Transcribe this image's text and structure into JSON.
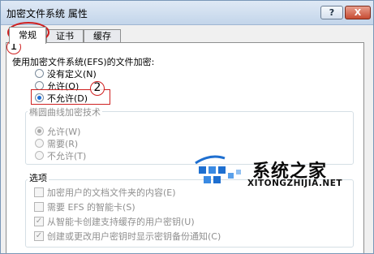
{
  "window": {
    "title": "加密文件系统 属性",
    "help_label": "?",
    "close_label": "X"
  },
  "tabs": [
    {
      "label": "常规",
      "active": true
    },
    {
      "label": "证书",
      "active": false
    },
    {
      "label": "缓存",
      "active": false
    }
  ],
  "efs": {
    "heading": "使用加密文件系统(EFS)的文件加密:",
    "options": [
      {
        "label": "没有定义(N)",
        "selected": false
      },
      {
        "label": "允许(O)",
        "selected": false
      },
      {
        "label": "不允许(D)",
        "selected": true
      }
    ]
  },
  "ecc": {
    "legend": "椭圆曲线加密技术",
    "options": [
      {
        "label": "允许(W)",
        "selected": true
      },
      {
        "label": "需要(R)",
        "selected": false
      },
      {
        "label": "不允许(T)",
        "selected": false
      }
    ]
  },
  "opts": {
    "legend": "选项",
    "checks": [
      {
        "label": "加密用户的文档文件夹的内容(E)",
        "checked": false
      },
      {
        "label": "需要 EFS 的智能卡(S)",
        "checked": false
      },
      {
        "label": "从智能卡创建支持缓存的用户密钥(U)",
        "checked": true
      },
      {
        "label": "创建或更改用户密钥时显示密钥备份通知(C)",
        "checked": true
      }
    ]
  },
  "annotations": {
    "step1": "1",
    "step2": "2"
  },
  "watermark": {
    "name": "系统之家",
    "url": "XITONGZHIJIA.NET"
  },
  "colors": {
    "annotation_red": "#cf2020",
    "radio_selected": "#1d6ed8",
    "watermark_blue": "#1e6fd0"
  }
}
